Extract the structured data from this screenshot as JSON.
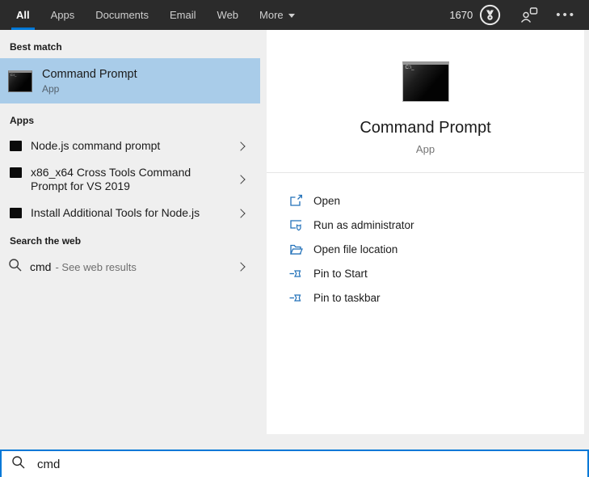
{
  "header": {
    "tabs": [
      {
        "label": "All",
        "active": true
      },
      {
        "label": "Apps",
        "active": false
      },
      {
        "label": "Documents",
        "active": false
      },
      {
        "label": "Email",
        "active": false
      },
      {
        "label": "Web",
        "active": false
      },
      {
        "label": "More",
        "active": false,
        "has_dropdown": true
      }
    ],
    "rewards_points": "1670",
    "icons": {
      "rewards": "medal-in-circle",
      "feedback": "person-with-chat-bubble",
      "options": "ellipsis"
    }
  },
  "left_panel": {
    "best_match_label": "Best match",
    "best_match": {
      "title": "Command Prompt",
      "subtitle": "App",
      "icon": "command-prompt-terminal"
    },
    "apps_label": "Apps",
    "app_items": [
      {
        "label": "Node.js command prompt",
        "icon": "terminal"
      },
      {
        "label": "x86_x64 Cross Tools Command Prompt for VS 2019",
        "icon": "terminal"
      },
      {
        "label": "Install Additional Tools for Node.js",
        "icon": "terminal"
      }
    ],
    "search_web_label": "Search the web",
    "web_item": {
      "query": "cmd",
      "suffix": "- See web results",
      "icon": "magnifier"
    }
  },
  "right_panel": {
    "title": "Command Prompt",
    "subtitle": "App",
    "icon": "command-prompt-terminal-large",
    "actions": [
      {
        "label": "Open",
        "icon": "open-window"
      },
      {
        "label": "Run as administrator",
        "icon": "window-with-shield"
      },
      {
        "label": "Open file location",
        "icon": "open-folder"
      },
      {
        "label": "Pin to Start",
        "icon": "pushpin"
      },
      {
        "label": "Pin to taskbar",
        "icon": "pushpin"
      }
    ]
  },
  "search_bar": {
    "value": "cmd",
    "icon": "magnifier"
  },
  "colors": {
    "header_bg": "#2b2b2b",
    "accent_blue": "#0078d7",
    "highlight_blue": "#a9cce9",
    "panel_bg": "#efefef",
    "card_bg": "#ffffff",
    "action_icon_blue": "#2271b9"
  }
}
